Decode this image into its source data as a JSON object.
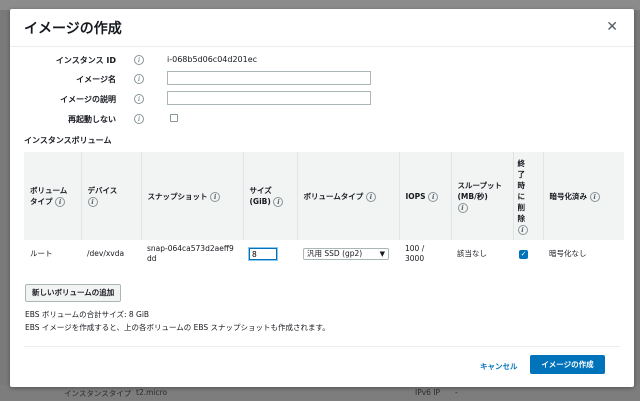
{
  "dialog": {
    "title": "イメージの作成",
    "close_glyph": "✕"
  },
  "form": {
    "instance_id_label": "インスタンス ID",
    "instance_id_value": "i-068b5d06c04d201ec",
    "image_name_label": "イメージ名",
    "image_name_value": "",
    "image_desc_label": "イメージの説明",
    "image_desc_value": "",
    "no_reboot_label": "再起動しない",
    "no_reboot_checked": false
  },
  "info_glyph": "i",
  "volumes": {
    "section_title": "インスタンスボリューム",
    "headers": {
      "volume_type": "ボリューム タイプ",
      "device": "デバイス",
      "snapshot": "スナップショット",
      "size": "サイズ (GiB)",
      "volume_kind": "ボリュームタイプ",
      "iops": "IOPS",
      "throughput": "スループット (MB/秒)",
      "delete_on_term": "終了時に削除",
      "encrypted": "暗号化済み"
    },
    "rows": [
      {
        "volume_type": "ルート",
        "device": "/dev/xvda",
        "snapshot": "snap-064ca573d2aeff9dd",
        "size": "8",
        "volume_kind": "汎用 SSD (gp2)",
        "iops": "100 / 3000",
        "throughput": "該当なし",
        "delete_on_term": true,
        "encrypted": "暗号化なし"
      }
    ],
    "add_button": "新しいボリュームの追加"
  },
  "summary": {
    "total_size": "EBS ボリュームの合計サイズ: 8 GiB",
    "note": "EBS イメージを作成すると、上の各ボリュームの EBS スナップショットも作成されます。"
  },
  "footer": {
    "cancel": "キャンセル",
    "create": "イメージの作成"
  },
  "background": {
    "instance_type_label": "インスタンスタイプ",
    "instance_type_value": "t2.micro",
    "ipv6_label": "IPv6 IP",
    "ipv6_value": "-"
  },
  "colors": {
    "primary": "#0073bb",
    "header_bg": "#f2f3f3"
  }
}
